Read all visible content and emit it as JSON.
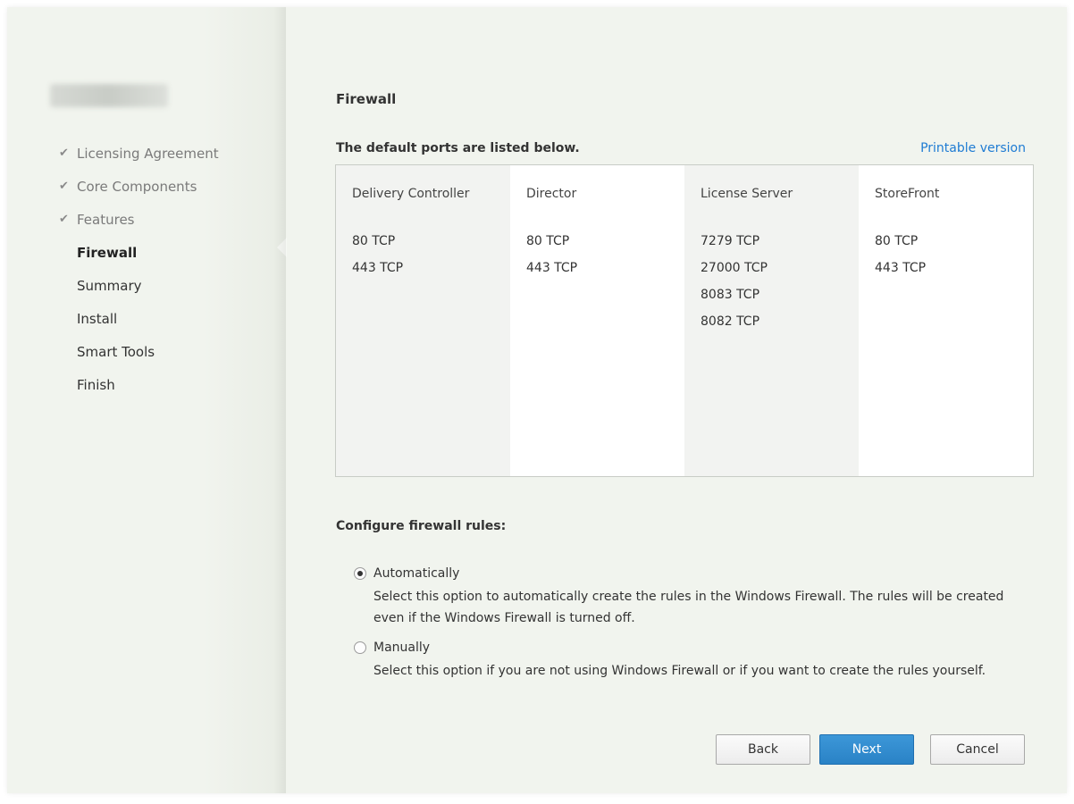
{
  "sidebar": {
    "steps": [
      {
        "label": "Licensing Agreement",
        "state": "done"
      },
      {
        "label": "Core Components",
        "state": "done"
      },
      {
        "label": "Features",
        "state": "done"
      },
      {
        "label": "Firewall",
        "state": "active"
      },
      {
        "label": "Summary",
        "state": "pending"
      },
      {
        "label": "Install",
        "state": "pending"
      },
      {
        "label": "Smart Tools",
        "state": "pending"
      },
      {
        "label": "Finish",
        "state": "pending"
      }
    ],
    "check_glyph": "✔"
  },
  "main": {
    "title": "Firewall",
    "ports_intro": "The default ports are listed below.",
    "printable_link": "Printable version",
    "columns": [
      {
        "header": "Delivery Controller",
        "ports": [
          "80 TCP",
          "443 TCP"
        ]
      },
      {
        "header": "Director",
        "ports": [
          "80 TCP",
          "443 TCP"
        ]
      },
      {
        "header": "License Server",
        "ports": [
          "7279 TCP",
          "27000 TCP",
          "8083 TCP",
          "8082 TCP"
        ]
      },
      {
        "header": "StoreFront",
        "ports": [
          "80 TCP",
          "443 TCP"
        ]
      }
    ],
    "config_title": "Configure firewall rules:",
    "options": [
      {
        "label": "Automatically",
        "selected": true,
        "description": "Select this option to automatically create the rules in the Windows Firewall.  The rules will be created even if the Windows Firewall is turned off."
      },
      {
        "label": "Manually",
        "selected": false,
        "description": "Select this option if you are not using Windows Firewall or if you want to create the rules yourself."
      }
    ]
  },
  "buttons": {
    "back": "Back",
    "next": "Next",
    "cancel": "Cancel"
  },
  "colors": {
    "accent": "#2a82c6",
    "link": "#1e7bd3",
    "background": "#f1f4ee"
  }
}
